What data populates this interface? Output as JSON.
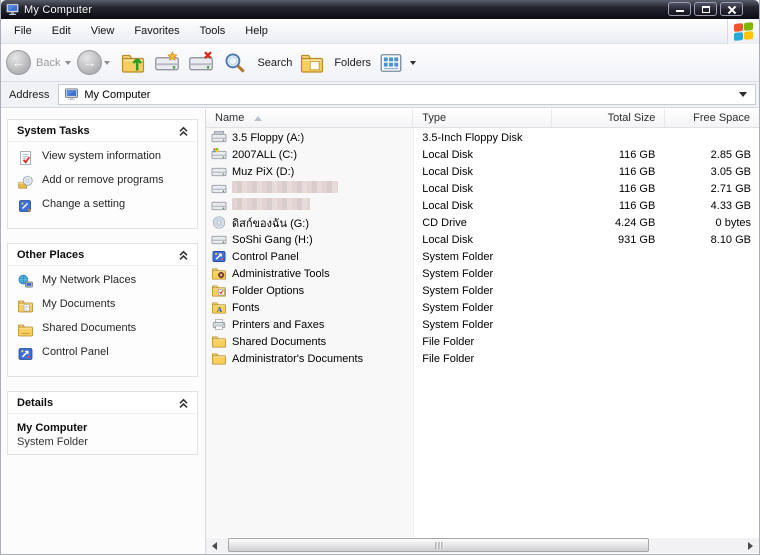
{
  "window": {
    "title": "My Computer"
  },
  "menu": {
    "items": [
      "File",
      "Edit",
      "View",
      "Favorites",
      "Tools",
      "Help"
    ]
  },
  "toolbar": {
    "back_label": "Back",
    "search_label": "Search",
    "folders_label": "Folders",
    "icons": [
      "back-icon",
      "forward-icon",
      "up-folder-icon",
      "map-drive-icon",
      "disconnect-drive-icon",
      "search-icon",
      "folders-icon",
      "views-icon"
    ]
  },
  "address": {
    "label": "Address",
    "value": "My Computer",
    "icon": "my-computer-icon"
  },
  "sidebar": {
    "system_tasks": {
      "title": "System Tasks",
      "items": [
        {
          "label": "View system information",
          "icon": "system-info-icon"
        },
        {
          "label": "Add or remove programs",
          "icon": "add-remove-programs-icon"
        },
        {
          "label": "Change a setting",
          "icon": "change-setting-icon"
        }
      ]
    },
    "other_places": {
      "title": "Other Places",
      "items": [
        {
          "label": "My Network Places",
          "icon": "network-places-icon"
        },
        {
          "label": "My Documents",
          "icon": "my-documents-icon"
        },
        {
          "label": "Shared Documents",
          "icon": "shared-documents-icon"
        },
        {
          "label": "Control Panel",
          "icon": "control-panel-icon"
        }
      ]
    },
    "details": {
      "title": "Details",
      "name": "My Computer",
      "type": "System Folder"
    }
  },
  "list": {
    "columns": [
      "Name",
      "Type",
      "Total Size",
      "Free Space"
    ],
    "sort_column": "Name",
    "sort_direction": "ascending",
    "rows": [
      {
        "name": "3.5 Floppy (A:)",
        "type": "3.5-Inch Floppy Disk",
        "total_size": "",
        "free_space": "",
        "icon": "floppy-drive-icon"
      },
      {
        "name": "2007ALL (C:)",
        "type": "Local Disk",
        "total_size": "116 GB",
        "free_space": "2.85 GB",
        "icon": "system-drive-icon"
      },
      {
        "name": "Muz PiX (D:)",
        "type": "Local Disk",
        "total_size": "116 GB",
        "free_space": "3.05 GB",
        "icon": "hard-drive-icon"
      },
      {
        "name": "",
        "redacted": true,
        "type": "Local Disk",
        "total_size": "116 GB",
        "free_space": "2.71 GB",
        "icon": "hard-drive-icon"
      },
      {
        "name": "",
        "redacted": true,
        "redacted_narrow": true,
        "type": "Local Disk",
        "total_size": "116 GB",
        "free_space": "4.33 GB",
        "icon": "hard-drive-icon"
      },
      {
        "name": "ดิสก์ของฉัน (G:)",
        "type": "CD Drive",
        "total_size": "4.24 GB",
        "free_space": "0 bytes",
        "icon": "cd-drive-icon"
      },
      {
        "name": "SoShi Gang (H:)",
        "type": "Local Disk",
        "total_size": "931 GB",
        "free_space": "8.10 GB",
        "icon": "hard-drive-icon"
      },
      {
        "name": "Control Panel",
        "type": "System Folder",
        "total_size": "",
        "free_space": "",
        "icon": "control-panel-icon"
      },
      {
        "name": "Administrative Tools",
        "type": "System Folder",
        "total_size": "",
        "free_space": "",
        "icon": "admin-tools-icon"
      },
      {
        "name": "Folder Options",
        "type": "System Folder",
        "total_size": "",
        "free_space": "",
        "icon": "folder-options-icon"
      },
      {
        "name": "Fonts",
        "type": "System Folder",
        "total_size": "",
        "free_space": "",
        "icon": "fonts-folder-icon"
      },
      {
        "name": "Printers and Faxes",
        "type": "System Folder",
        "total_size": "",
        "free_space": "",
        "icon": "printer-icon"
      },
      {
        "name": "Shared Documents",
        "type": "File Folder",
        "total_size": "",
        "free_space": "",
        "icon": "folder-icon"
      },
      {
        "name": "Administrator's Documents",
        "type": "File Folder",
        "total_size": "",
        "free_space": "",
        "icon": "folder-icon"
      }
    ]
  },
  "colors": {
    "titlebar": "#14151f",
    "folder_yellow": "#f6cf5f",
    "menubar": "#eef0f6",
    "header_gray": "#f4f4f6"
  }
}
